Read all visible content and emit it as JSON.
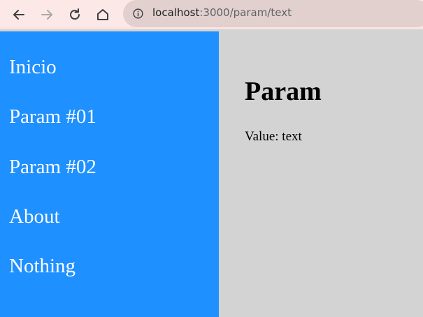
{
  "browser": {
    "url_host": "localhost",
    "url_path": ":3000/param/text",
    "icons": [
      "back-arrow-icon",
      "forward-arrow-icon",
      "reload-icon",
      "home-icon",
      "site-info-icon"
    ]
  },
  "sidebar": {
    "items": [
      {
        "label": "Inicio"
      },
      {
        "label": "Param #01"
      },
      {
        "label": "Param #02"
      },
      {
        "label": "About"
      },
      {
        "label": "Nothing"
      }
    ]
  },
  "main": {
    "title": "Param",
    "value_label": "Value:",
    "value": "text"
  },
  "colors": {
    "sidebar_bg": "#1e90ff",
    "main_bg": "#d3d3d3",
    "toolbar_bg": "#fce8e6"
  }
}
